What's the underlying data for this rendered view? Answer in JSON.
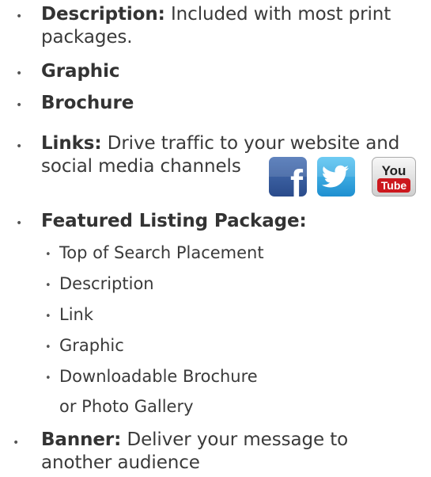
{
  "items": [
    {
      "label": "Description:",
      "text": "Included with most print",
      "text2": "packages."
    },
    {
      "label": "Graphic"
    },
    {
      "label": "Brochure"
    },
    {
      "label": "Links:",
      "text": "Drive traffic to your website and",
      "text2": "social media channels"
    },
    {
      "label": "Featured Listing Package:"
    },
    {
      "label": "Banner:",
      "text": "Deliver your message to",
      "text2": "another audience"
    }
  ],
  "featured_sub": [
    "Top of Search Placement",
    "Description",
    "Link",
    "Graphic",
    "Downloadable Brochure",
    "or Photo Gallery"
  ],
  "social": {
    "facebook_icon": "f",
    "youtube_top": "You",
    "youtube_bottom": "Tube",
    "colors": {
      "facebook": "#3b5998",
      "twitter": "#1da1f2",
      "youtube": "#cc181e"
    }
  },
  "bullet_char": "•"
}
